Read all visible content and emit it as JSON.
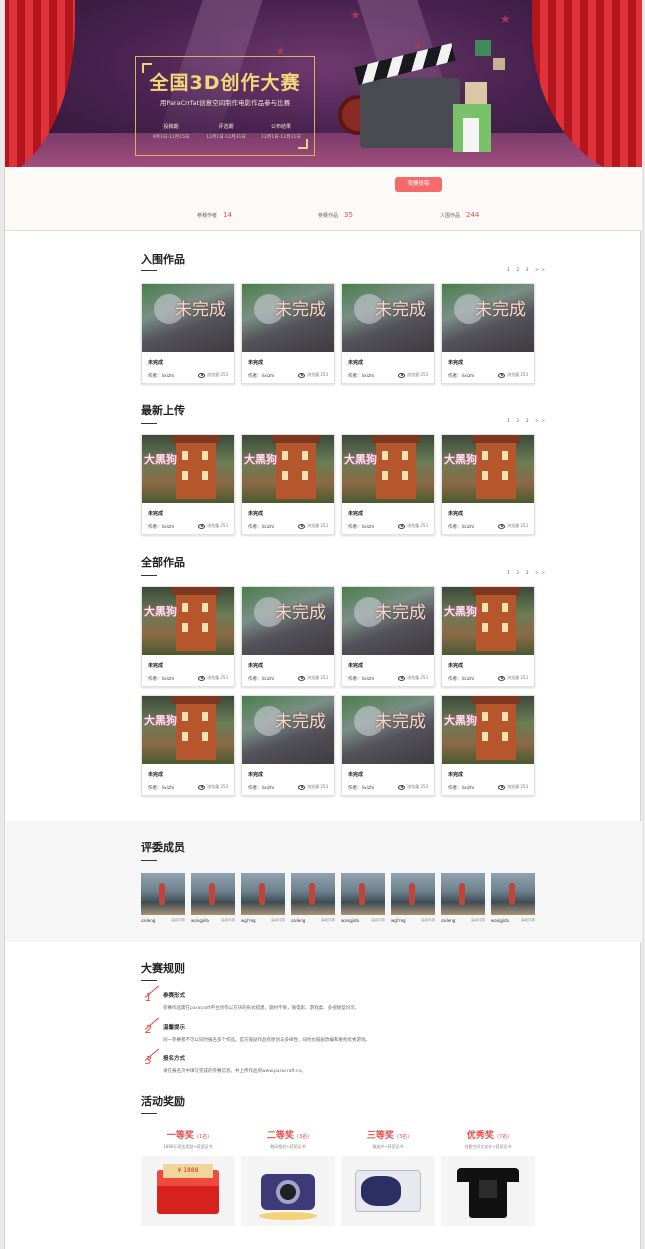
{
  "banner": {
    "title": "全国3D创作大赛",
    "subtitle": "用ParaCrrfat创意空间制作电影作品参与比赛",
    "phases": [
      {
        "name": "投稿期",
        "date": "9月1日-11月15日"
      },
      {
        "name": "评选期",
        "date": "12月1日-12月31日"
      },
      {
        "name": "公布结果",
        "date": "12月1日-12月31日"
      }
    ]
  },
  "stats": {
    "submit_label": "我要投稿",
    "items": [
      {
        "label": "参赛作者",
        "value": "14"
      },
      {
        "label": "参赛作品",
        "value": "35"
      },
      {
        "label": "入围作品",
        "value": "244"
      }
    ]
  },
  "pager": [
    "1",
    "2",
    "3",
    ">>"
  ],
  "sections": [
    {
      "title": "入围作品",
      "cards": [
        {
          "thumb": "a",
          "caption": "未完成",
          "name": "未完成",
          "author": "作者：lixizhi",
          "views_label": "浏览量",
          "views": "253"
        },
        {
          "thumb": "a",
          "caption": "未完成",
          "name": "未完成",
          "author": "作者：lixizhi",
          "views_label": "浏览量",
          "views": "253"
        },
        {
          "thumb": "a",
          "caption": "未完成",
          "name": "未完成",
          "author": "作者：lixizhi",
          "views_label": "浏览量",
          "views": "253"
        },
        {
          "thumb": "a",
          "caption": "未完成",
          "name": "未完成",
          "author": "作者：lixizhi",
          "views_label": "浏览量",
          "views": "253"
        }
      ]
    },
    {
      "title": "最新上传",
      "cards": [
        {
          "thumb": "b",
          "caption": "大黑狗",
          "name": "未完成",
          "author": "作者：lixizhi",
          "views_label": "浏览量",
          "views": "253"
        },
        {
          "thumb": "b",
          "caption": "大黑狗",
          "name": "未完成",
          "author": "作者：lixizhi",
          "views_label": "浏览量",
          "views": "253"
        },
        {
          "thumb": "b",
          "caption": "大黑狗",
          "name": "未完成",
          "author": "作者：lixizhi",
          "views_label": "浏览量",
          "views": "253"
        },
        {
          "thumb": "b",
          "caption": "大黑狗",
          "name": "未完成",
          "author": "作者：lixizhi",
          "views_label": "浏览量",
          "views": "253"
        }
      ]
    },
    {
      "title": "全部作品",
      "cards": [
        {
          "thumb": "b",
          "caption": "大黑狗",
          "name": "未完成",
          "author": "作者：lixizhi",
          "views_label": "浏览量",
          "views": "253"
        },
        {
          "thumb": "a",
          "caption": "未完成",
          "name": "未完成",
          "author": "作者：lixizhi",
          "views_label": "浏览量",
          "views": "253"
        },
        {
          "thumb": "a",
          "caption": "未完成",
          "name": "未完成",
          "author": "作者：lixizhi",
          "views_label": "浏览量",
          "views": "253"
        },
        {
          "thumb": "b",
          "caption": "大黑狗",
          "name": "未完成",
          "author": "作者：lixizhi",
          "views_label": "浏览量",
          "views": "253"
        },
        {
          "thumb": "b",
          "caption": "大黑狗",
          "name": "未完成",
          "author": "作者：lixizhi",
          "views_label": "浏览量",
          "views": "253"
        },
        {
          "thumb": "a",
          "caption": "未完成",
          "name": "未完成",
          "author": "作者：lixizhi",
          "views_label": "浏览量",
          "views": "253"
        },
        {
          "thumb": "a",
          "caption": "未完成",
          "name": "未完成",
          "author": "作者：lixizhi",
          "views_label": "浏览量",
          "views": "253"
        },
        {
          "thumb": "b",
          "caption": "大黑狗",
          "name": "未完成",
          "author": "作者：lixizhi",
          "views_label": "浏览量",
          "views": "253"
        }
      ]
    }
  ],
  "judges": {
    "title": "评委成员",
    "members": [
      {
        "name": "saileng",
        "role": "高级评委"
      },
      {
        "name": "wangjida",
        "role": "高级评委"
      },
      {
        "name": "wgl'reg",
        "role": "高级评委"
      },
      {
        "name": "saileng",
        "role": "高级评委"
      },
      {
        "name": "wangjida",
        "role": "高级评委"
      },
      {
        "name": "wgl'reg",
        "role": "高级评委"
      },
      {
        "name": "saileng",
        "role": "高级评委"
      },
      {
        "name": "wangjida",
        "role": "高级评委"
      },
      {
        "name": "wgl'reg",
        "role": "高级评委"
      }
    ]
  },
  "rules": {
    "title": "大赛规则",
    "items": [
      {
        "num": "1",
        "title": "参赛形式",
        "desc": "参赛作品需在paracraft平台创作以方块的形式搭建，题材不限，微电影、游戏类、多视频型均可。"
      },
      {
        "num": "2",
        "title": "温馨提示",
        "desc": "同一参赛者不可以同时报名多个作品。官方鼓励作品有原创与多样性，同时也鼓励改编和重构优秀游戏。"
      },
      {
        "num": "3",
        "title": "报名方式",
        "desc": "请在报名页中填写完成的参赛信息，并上传作品到www.paracraft.cn。"
      }
    ]
  },
  "prizes": {
    "title": "活动奖励",
    "items": [
      {
        "title": "一等奖",
        "count": "(1名)",
        "desc": "1888元现金奖励+获奖证书",
        "gift": "red-envelope",
        "gift_text": "¥ 1888"
      },
      {
        "title": "二等奖",
        "count": "(3名)",
        "desc": "数码相机+获奖证书",
        "gift": "camera"
      },
      {
        "title": "三等奖",
        "count": "(3名)",
        "desc": "微波炉+获奖证书",
        "gift": "microwave"
      },
      {
        "title": "优秀奖",
        "count": "(7名)",
        "desc": "创意空间文化衫+获奖证书",
        "gift": "t-shirt"
      }
    ]
  }
}
